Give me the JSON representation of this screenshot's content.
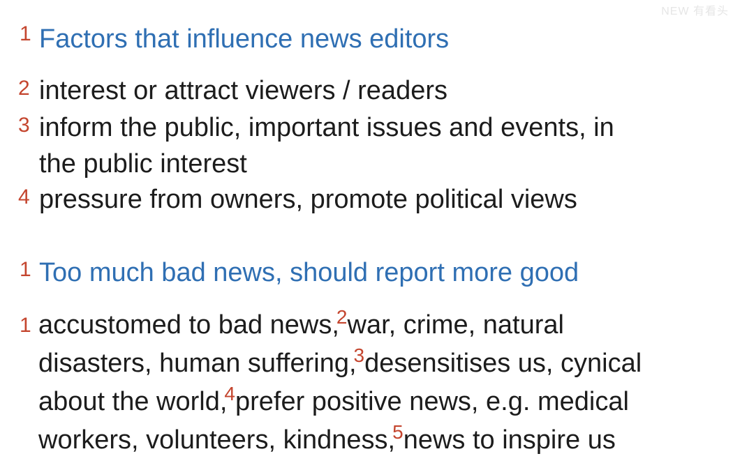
{
  "watermark": "NEW 有看头",
  "section1": {
    "number": "1",
    "heading": "Factors that influence news editors",
    "points": [
      {
        "number": "2",
        "lines": [
          "interest or attract viewers / readers"
        ]
      },
      {
        "number": "3",
        "lines": [
          "inform the public, important issues and events, in",
          "the public interest"
        ]
      },
      {
        "number": "4",
        "lines": [
          "pressure from owners, promote political views"
        ]
      }
    ]
  },
  "section2": {
    "number": "1",
    "heading": "Too much bad news, should report more good",
    "para_number": "1",
    "segments": [
      {
        "text": "accustomed to bad news,"
      },
      {
        "marker": "2",
        "text": "war, crime, natural disasters, human suffering,"
      },
      {
        "marker": "3",
        "text": "desensitises us, cynical about the world,"
      },
      {
        "marker": "4",
        "text": "prefer positive news, e.g. medical workers, volunteers, kindness,"
      },
      {
        "marker": "5",
        "text": "news to inspire us"
      }
    ]
  }
}
